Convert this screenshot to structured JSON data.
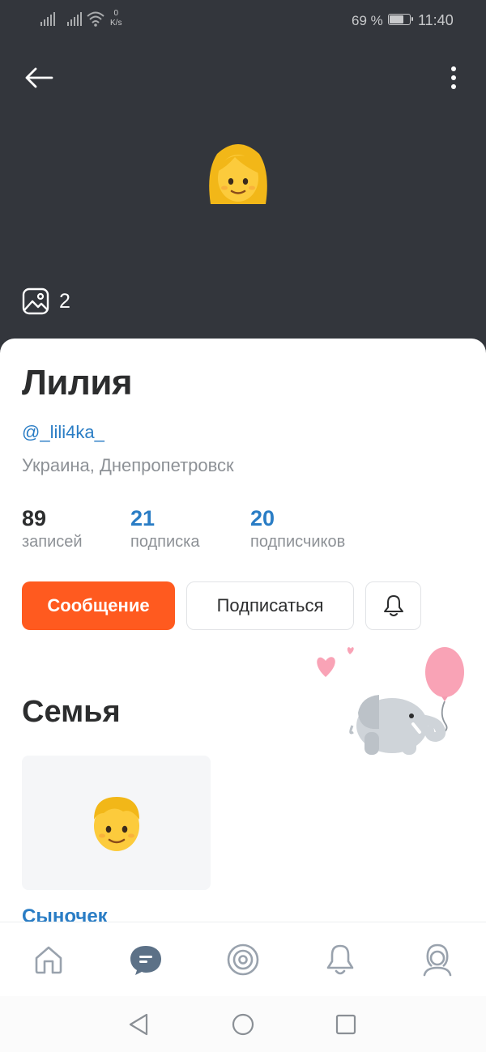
{
  "status_bar": {
    "speed_value": "0",
    "speed_unit": "K/s",
    "battery_percent": "69 %",
    "battery_level": 0.69,
    "time": "11:40"
  },
  "header": {
    "back_icon": "arrow-left-icon",
    "menu_icon": "more-vertical-icon",
    "avatar_emoji": "woman-emoji",
    "photos_icon": "image-icon",
    "photos_count": "2",
    "background_color": "#33363c"
  },
  "profile": {
    "name": "Лилия",
    "username": "@_lili4ka_",
    "location": "Украина, Днепропетровск",
    "stats": [
      {
        "value": "89",
        "label": "записей"
      },
      {
        "value": "21",
        "label": "подписка"
      },
      {
        "value": "20",
        "label": "подписчиков"
      }
    ],
    "actions": {
      "message": "Сообщение",
      "follow": "Подписаться",
      "bell_icon": "bell-icon"
    }
  },
  "family": {
    "title": "Семья",
    "illustration": "elephant-with-balloon",
    "members": [
      {
        "name": "Сыночек",
        "emoji": "boy-emoji"
      }
    ]
  },
  "tabbar": [
    {
      "icon": "home-icon"
    },
    {
      "icon": "messages-icon",
      "active": true
    },
    {
      "icon": "discover-icon"
    },
    {
      "icon": "notifications-icon"
    },
    {
      "icon": "profile-icon"
    }
  ],
  "system_nav": [
    "back-triangle-icon",
    "home-circle-icon",
    "recents-square-icon"
  ],
  "colors": {
    "accent_blue": "#2a7dc5",
    "accent_orange": "#ff5a1f",
    "text_dark": "#2c2d2e",
    "text_grey": "#8d9196"
  }
}
